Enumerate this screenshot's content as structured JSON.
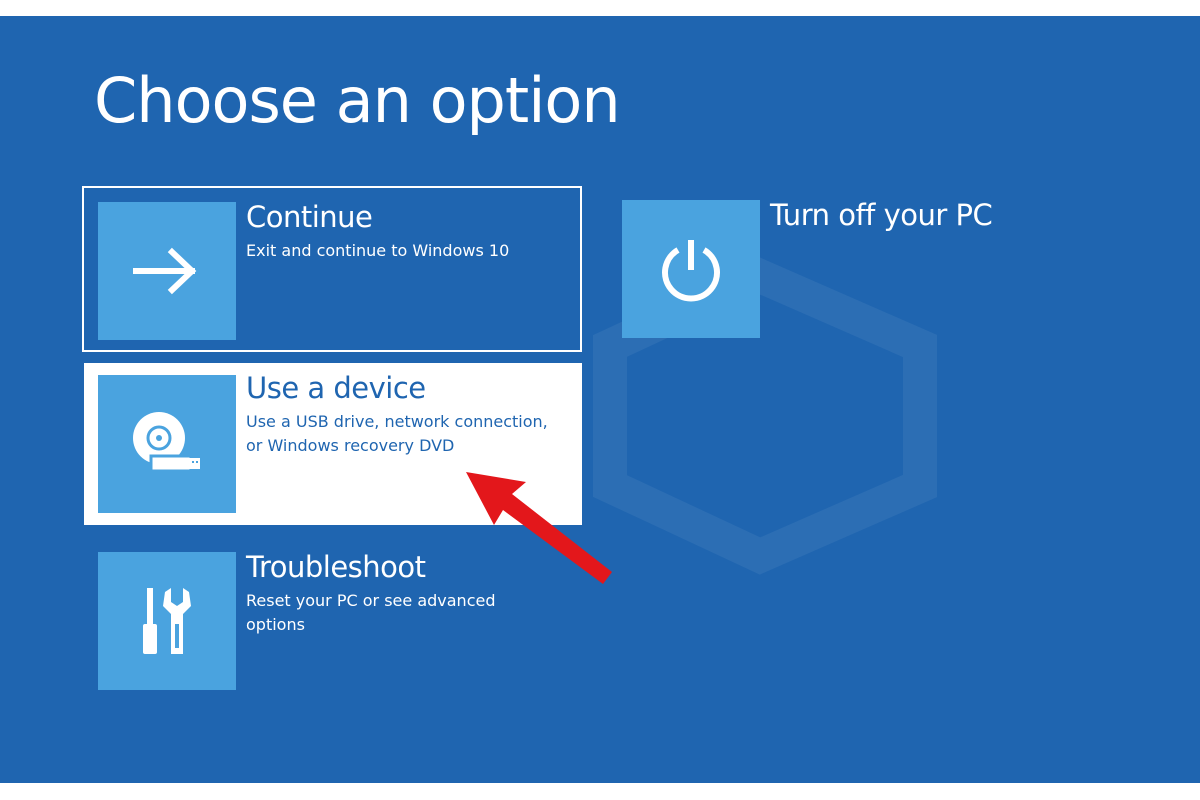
{
  "screen": {
    "title": "Choose an option",
    "background_color": "#1f65b0",
    "tile_icon_color": "#4aa3df"
  },
  "options": [
    {
      "id": "continue",
      "title": "Continue",
      "description": "Exit and continue to Windows 10",
      "icon": "arrow-right-icon",
      "state": "focused"
    },
    {
      "id": "turn-off",
      "title": "Turn off your PC",
      "description": "",
      "icon": "power-icon",
      "state": "normal"
    },
    {
      "id": "use-device",
      "title": "Use a device",
      "description": "Use a USB drive, network connection, or Windows recovery DVD",
      "icon": "disc-usb-icon",
      "state": "hover"
    },
    {
      "id": "troubleshoot",
      "title": "Troubleshoot",
      "description": "Reset your PC or see advanced options",
      "icon": "tools-icon",
      "state": "normal"
    }
  ],
  "annotation": {
    "icon": "red-arrow-pointer",
    "color": "#e3171b",
    "points_to": "use-device"
  }
}
